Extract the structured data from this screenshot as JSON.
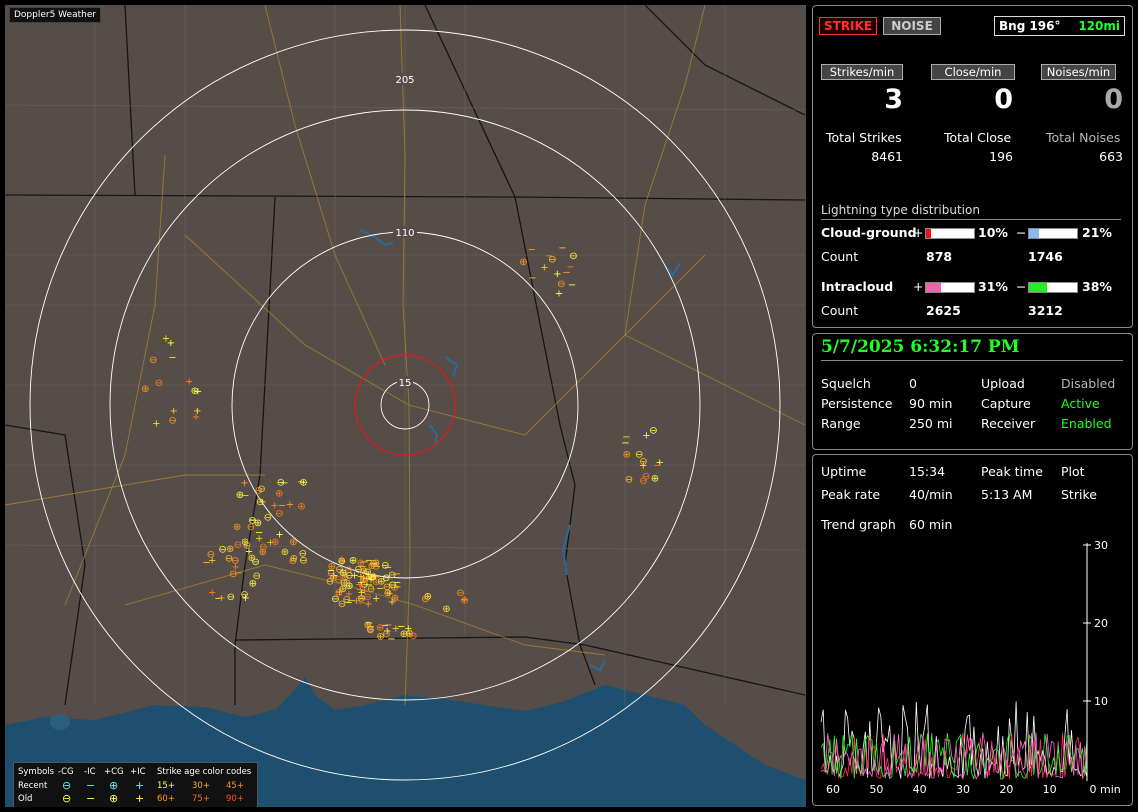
{
  "app": {
    "title": "Doppler5 Weather"
  },
  "colors": {
    "strike_mode": "#ff3030",
    "active": "#22ff22",
    "range_ring": "#ffffff",
    "close_ring": "#d02020",
    "recent": "#ffff40",
    "old_orange": "#ff8c20"
  },
  "map": {
    "ring_labels": [
      "205",
      "110",
      "15"
    ],
    "legend": {
      "symbols_label": "Symbols",
      "types": [
        "-CG",
        "-IC",
        "+CG",
        "+IC"
      ],
      "age_label": "Strike age color codes",
      "recent_label": "Recent",
      "old_label": "Old",
      "ages_recent": [
        "15+",
        "30+",
        "45+"
      ],
      "ages_old": [
        "60+",
        "75+",
        "90+"
      ],
      "glyphs": {
        "minus_cg": "⊖",
        "minus_ic": "−",
        "plus_cg": "⊕",
        "plus_ic": "+"
      }
    }
  },
  "status": {
    "strike_btn": "STRIKE",
    "noise_btn": "NOISE",
    "bearing": "Bng 196°",
    "distance": "120mi",
    "strikes_per_min_label": "Strikes/min",
    "close_per_min_label": "Close/min",
    "noises_per_min_label": "Noises/min",
    "strikes_per_min": "3",
    "close_per_min": "0",
    "noises_per_min": "0",
    "total_strikes_label": "Total Strikes",
    "total_close_label": "Total Close",
    "total_noises_label": "Total Noises",
    "total_strikes": "8461",
    "total_close": "196",
    "total_noises": "663"
  },
  "distribution": {
    "title": "Lightning type distribution",
    "cg_label": "Cloud-ground",
    "ic_label": "Intracloud",
    "count_label": "Count",
    "plus": "+",
    "minus": "−",
    "cg_plus_pct": "10%",
    "cg_minus_pct": "21%",
    "cg_plus_count": "878",
    "cg_minus_count": "1746",
    "ic_plus_pct": "31%",
    "ic_minus_pct": "38%",
    "ic_plus_count": "2625",
    "ic_minus_count": "3212",
    "fill": {
      "cg_plus": 0.1,
      "cg_minus": 0.21,
      "ic_plus": 0.31,
      "ic_minus": 0.38
    },
    "bar_colors": {
      "cg_plus": "#ee1111",
      "cg_minus": "#88bbee",
      "ic_plus": "#ee66aa",
      "ic_minus": "#22ee22"
    }
  },
  "settings": {
    "datetime": "5/7/2025 6:32:17 PM",
    "squelch_label": "Squelch",
    "squelch": "0",
    "persistence_label": "Persistence",
    "persistence": "90 min",
    "range_label": "Range",
    "range": "250 mi",
    "upload_label": "Upload",
    "upload": "Disabled",
    "capture_label": "Capture",
    "capture": "Active",
    "receiver_label": "Receiver",
    "receiver": "Enabled"
  },
  "stats": {
    "uptime_label": "Uptime",
    "uptime": "15:34",
    "peak_time_label": "Peak time",
    "peak_time": "5:13 AM",
    "plot_label": "Plot",
    "plot": "Strike",
    "peak_rate_label": "Peak rate",
    "peak_rate": "40/min",
    "trend_label": "Trend graph",
    "trend": "60 min"
  },
  "chart_data": {
    "type": "line",
    "x_ticks": [
      "60",
      "50",
      "40",
      "30",
      "20",
      "10",
      "0"
    ],
    "x_unit": "min",
    "y_ticks": [
      "30",
      "20",
      "10"
    ],
    "ylim": [
      0,
      30
    ],
    "xlim": [
      60,
      0
    ]
  }
}
